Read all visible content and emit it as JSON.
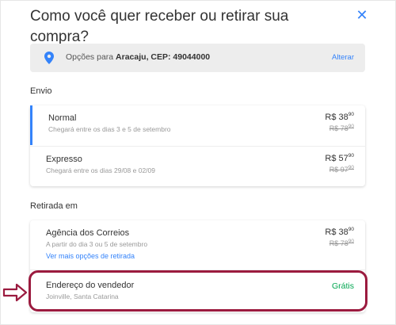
{
  "modal": {
    "title": "Como você quer receber ou retirar sua compra?",
    "close_icon": "close-icon"
  },
  "location": {
    "icon": "map-pin-icon",
    "prefix": "Opções para ",
    "place": "Aracaju, CEP: 49044000",
    "change_label": "Alterar"
  },
  "shipping": {
    "section_label": "Envio",
    "options": [
      {
        "name": "Normal",
        "subtitle": "Chegará entre os dias 3 e 5 de setembro",
        "price_int": "R$ 38",
        "price_cents": "90",
        "old_int": "R$ 78",
        "old_cents": "90",
        "selected": true
      },
      {
        "name": "Expresso",
        "subtitle": "Chegará entre os dias 29/08 e 02/09",
        "price_int": "R$ 57",
        "price_cents": "90",
        "old_int": "R$ 97",
        "old_cents": "90",
        "selected": false
      }
    ]
  },
  "pickup": {
    "section_label": "Retirada em",
    "agency": {
      "name": "Agência dos Correios",
      "subtitle": "A partir do dia 3 ou 5 de setembro",
      "price_int": "R$ 38",
      "price_cents": "90",
      "old_int": "R$ 78",
      "old_cents": "90",
      "more_link": "Ver mais opções de retirada"
    },
    "seller": {
      "name": "Endereço do vendedor",
      "subtitle": "Joinville, Santa Catarina",
      "price": "Grátis"
    }
  },
  "colors": {
    "accent": "#3483fa",
    "free": "#00a650",
    "highlight": "#9b1b3f"
  },
  "annotation": {
    "arrow_icon": "right-arrow-outline-icon"
  }
}
